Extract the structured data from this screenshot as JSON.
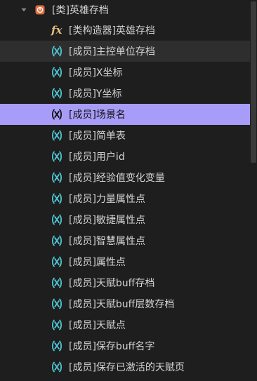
{
  "tree": {
    "class_node": {
      "label": "[类]英雄存档",
      "expanded": true,
      "icon": "class-icon",
      "icon_color": "#e06c3c"
    },
    "items": [
      {
        "label": "[类构造器]英雄存档",
        "kind": "constructor",
        "icon": "fx-icon"
      },
      {
        "label": "[成员]主控单位存档",
        "kind": "member",
        "icon": "member-icon",
        "state": "hover"
      },
      {
        "label": "[成员]X坐标",
        "kind": "member",
        "icon": "member-icon"
      },
      {
        "label": "[成员]Y坐标",
        "kind": "member",
        "icon": "member-icon"
      },
      {
        "label": "[成员]场景名",
        "kind": "member",
        "icon": "member-icon",
        "state": "selected"
      },
      {
        "label": "[成员]简单表",
        "kind": "member",
        "icon": "member-icon"
      },
      {
        "label": "[成员]用户id",
        "kind": "member",
        "icon": "member-icon"
      },
      {
        "label": "[成员]经验值变化变量",
        "kind": "member",
        "icon": "member-icon"
      },
      {
        "label": "[成员]力量属性点",
        "kind": "member",
        "icon": "member-icon"
      },
      {
        "label": "[成员]敏捷属性点",
        "kind": "member",
        "icon": "member-icon"
      },
      {
        "label": "[成员]智慧属性点",
        "kind": "member",
        "icon": "member-icon"
      },
      {
        "label": "[成员]属性点",
        "kind": "member",
        "icon": "member-icon"
      },
      {
        "label": "[成员]天赋buff存档",
        "kind": "member",
        "icon": "member-icon"
      },
      {
        "label": "[成员]天赋buff层数存档",
        "kind": "member",
        "icon": "member-icon"
      },
      {
        "label": "[成员]天赋点",
        "kind": "member",
        "icon": "member-icon"
      },
      {
        "label": "[成员]保存buff名字",
        "kind": "member",
        "icon": "member-icon"
      },
      {
        "label": "[成员]保存已激活的天赋页",
        "kind": "member",
        "icon": "member-icon"
      }
    ]
  },
  "colors": {
    "background": "#1e1e1e",
    "hover": "#2e2e2e",
    "selected": "#a79cf8",
    "member_icon": "#4ec9d6",
    "constructor_icon": "#e5c07b"
  }
}
